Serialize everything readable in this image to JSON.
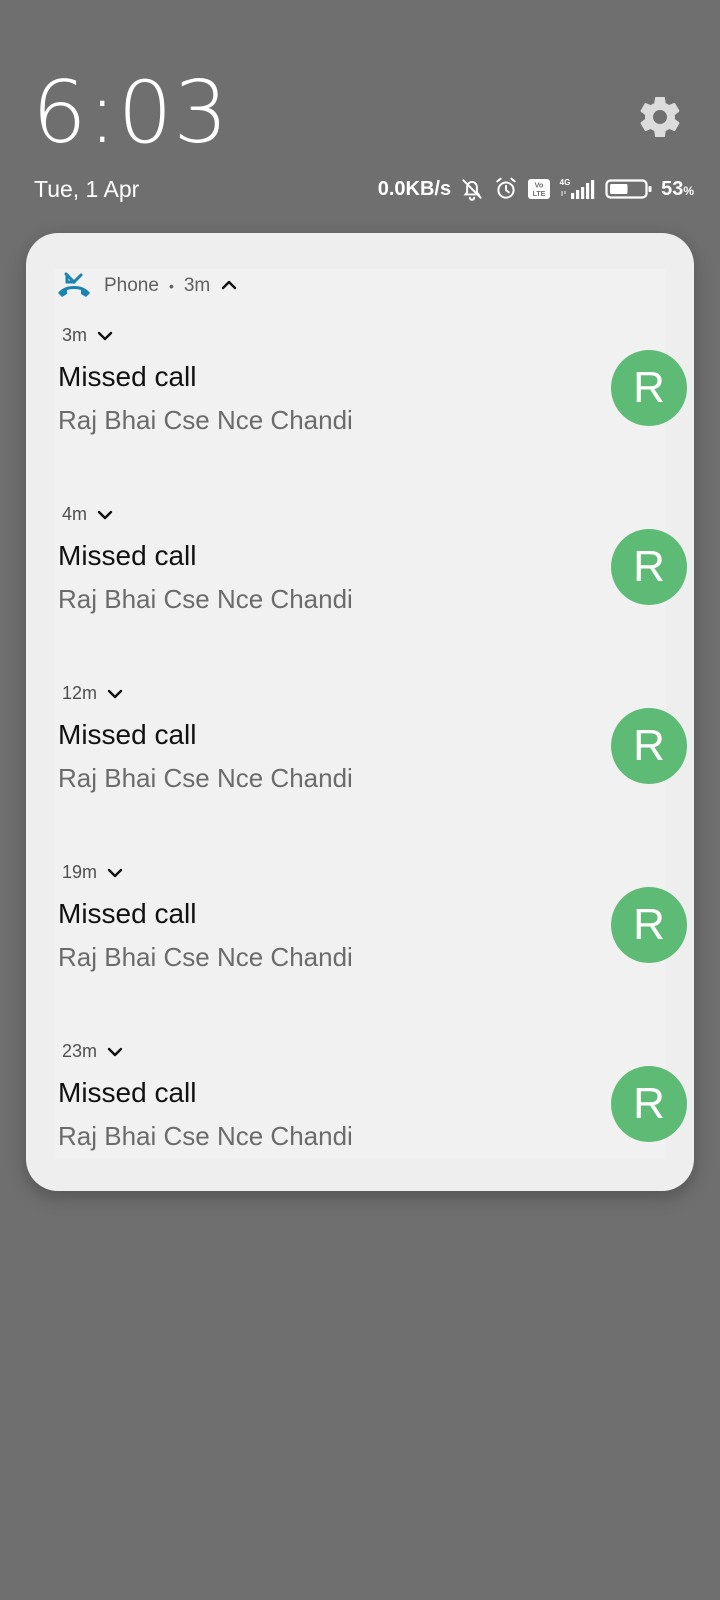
{
  "lockscreen": {
    "time": "6:03",
    "date": "Tue, 1 Apr",
    "settings_icon": "gear-icon"
  },
  "status_bar": {
    "net_speed": "0.0KB/s",
    "icons": [
      "bell-off-icon",
      "alarm-icon",
      "volte-icon",
      "signal-4g-icon"
    ],
    "signal_label": "4G",
    "volte_label": "Vo LTE",
    "battery_level": 0.53,
    "battery_percent": "53",
    "battery_unit": "%"
  },
  "notification_group": {
    "app_name": "Phone",
    "separator": "•",
    "age": "3m",
    "app_icon": "missed-call-icon",
    "accent": "#1a83b0",
    "items": [
      {
        "age": "3m",
        "title": "Missed call",
        "text": "Raj Bhai Cse Nce Chandi",
        "avatar_letter": "R"
      },
      {
        "age": "4m",
        "title": "Missed call",
        "text": "Raj Bhai Cse Nce Chandi",
        "avatar_letter": "R"
      },
      {
        "age": "12m",
        "title": "Missed call",
        "text": "Raj Bhai Cse Nce Chandi",
        "avatar_letter": "R"
      },
      {
        "age": "19m",
        "title": "Missed call",
        "text": "Raj Bhai Cse Nce Chandi",
        "avatar_letter": "R"
      },
      {
        "age": "23m",
        "title": "Missed call",
        "text": "Raj Bhai Cse Nce Chandi",
        "avatar_letter": "R"
      }
    ],
    "avatar_color": "#5dbb75"
  }
}
